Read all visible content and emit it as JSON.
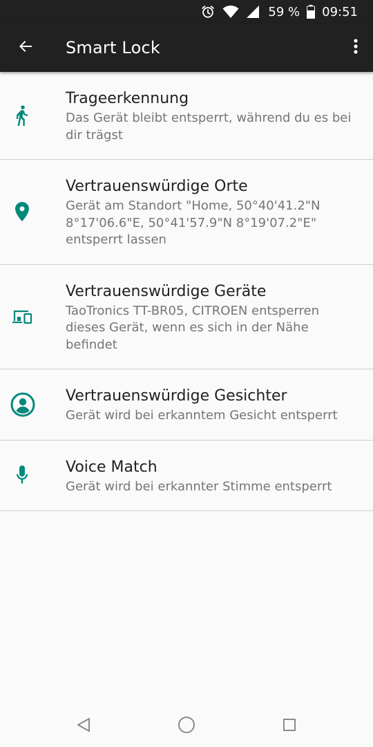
{
  "status_bar": {
    "battery_percent": "59 %",
    "time": "09:51",
    "icons": [
      "alarm-icon",
      "wifi-icon",
      "cell-signal-icon",
      "battery-icon"
    ]
  },
  "app_bar": {
    "title": "Smart Lock",
    "back_icon": "arrow-back-icon",
    "menu_icon": "more-vert-icon"
  },
  "items": [
    {
      "icon": "walk-icon",
      "title": "Trageerkennung",
      "summary": "Das Gerät bleibt entsperrt, während du es bei dir trägst"
    },
    {
      "icon": "location-pin-icon",
      "title": "Vertrauenswürdige Orte",
      "summary": "Gerät am Standort \"Home, 50°40'41.2\"N 8°17'06.6\"E, 50°41'57.9\"N 8°19'07.2\"E\" entsperrt lassen"
    },
    {
      "icon": "devices-icon",
      "title": "Vertrauenswürdige Geräte",
      "summary": "TaoTronics TT-BR05, CITROEN entsperren dieses Gerät, wenn es sich in der Nähe befindet"
    },
    {
      "icon": "face-icon",
      "title": "Vertrauenswürdige Gesichter",
      "summary": "Gerät wird bei erkanntem Gesicht entsperrt"
    },
    {
      "icon": "mic-icon",
      "title": "Voice Match",
      "summary": "Gerät wird bei erkannter Stimme entsperrt"
    }
  ],
  "nav_bar": {
    "icons": [
      "nav-back-icon",
      "nav-home-icon",
      "nav-recents-icon"
    ]
  },
  "colors": {
    "accent": "#00897b",
    "bar": "#212121",
    "background": "#fafafa",
    "title_text": "#212121",
    "summary_text": "#757575"
  }
}
